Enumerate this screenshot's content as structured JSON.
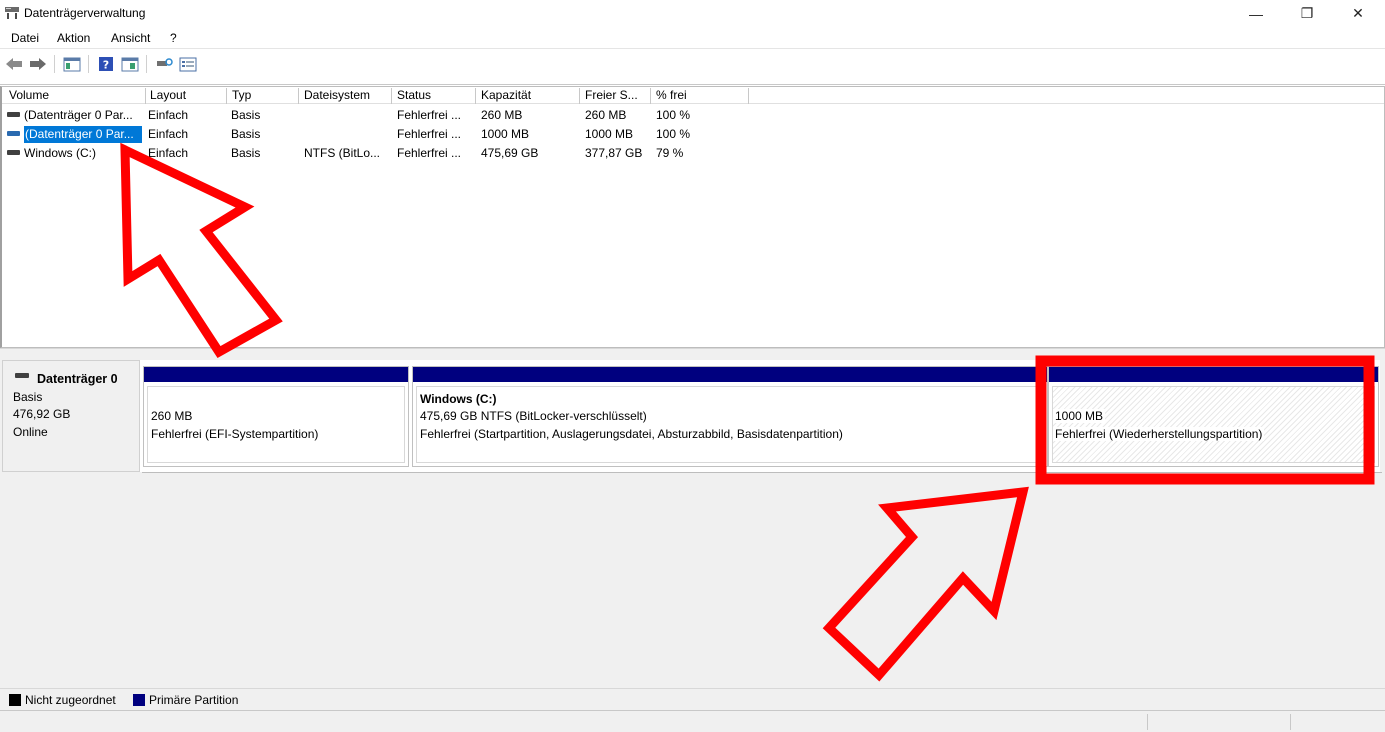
{
  "window": {
    "title": "Datenträgerverwaltung",
    "minimize_glyph": "—",
    "restore_glyph": "❐",
    "close_glyph": "✕"
  },
  "menu": [
    "Datei",
    "Aktion",
    "Ansicht",
    "?"
  ],
  "toolbar": {
    "icons": [
      "back-arrow-icon",
      "forward-arrow-icon",
      "console-tree-icon",
      "help-icon",
      "properties-icon",
      "rescan-disk-icon",
      "details-view-icon"
    ]
  },
  "volume_table": {
    "columns": [
      "Volume",
      "Layout",
      "Typ",
      "Dateisystem",
      "Status",
      "Kapazität",
      "Freier S...",
      "% frei"
    ],
    "rows": [
      {
        "volume": "(Datenträger 0 Par...",
        "layout": "Einfach",
        "typ": "Basis",
        "fs": "",
        "status": "Fehlerfrei ...",
        "capacity": "260 MB",
        "free": "260 MB",
        "pct": "100 %",
        "selected": false
      },
      {
        "volume": "(Datenträger 0 Par...",
        "layout": "Einfach",
        "typ": "Basis",
        "fs": "",
        "status": "Fehlerfrei ...",
        "capacity": "1000 MB",
        "free": "1000 MB",
        "pct": "100 %",
        "selected": true
      },
      {
        "volume": "Windows (C:)",
        "layout": "Einfach",
        "typ": "Basis",
        "fs": "NTFS (BitLo...",
        "status": "Fehlerfrei ...",
        "capacity": "475,69 GB",
        "free": "377,87 GB",
        "pct": "79 %",
        "selected": false
      }
    ]
  },
  "disk": {
    "name": "Datenträger 0",
    "type": "Basis",
    "size": "476,92 GB",
    "state": "Online",
    "partitions": [
      {
        "title": "",
        "size_line": "260 MB",
        "status_line": "Fehlerfrei (EFI-Systempartition)"
      },
      {
        "title": "Windows  (C:)",
        "size_line": "475,69 GB NTFS (BitLocker-verschlüsselt)",
        "status_line": "Fehlerfrei (Startpartition, Auslagerungsdatei, Absturzabbild, Basisdatenpartition)"
      },
      {
        "title": "",
        "size_line": "1000 MB",
        "status_line": "Fehlerfrei (Wiederherstellungspartition)"
      }
    ]
  },
  "legend": {
    "unallocated_label": "Nicht zugeordnet",
    "unallocated_color": "#000000",
    "primary_label": "Primäre Partition",
    "primary_color": "#00007f"
  },
  "annotation_color": "#ff0000",
  "selection_color": "#0078d7"
}
